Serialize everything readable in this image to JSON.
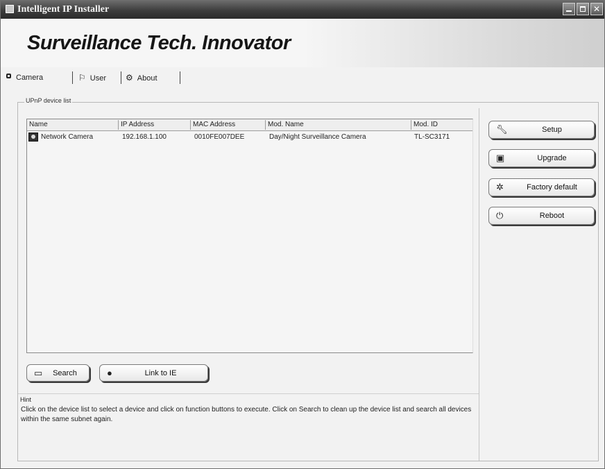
{
  "window": {
    "title": "Intelligent IP Installer"
  },
  "banner": {
    "brand": "Surveillance Tech. Innovator"
  },
  "tabs": [
    {
      "label": "Camera",
      "icon": "camera-icon"
    },
    {
      "label": "User",
      "icon": "user-icon"
    },
    {
      "label": "About",
      "icon": "info-icon"
    }
  ],
  "device_list": {
    "group_label": "UPnP device list",
    "columns": [
      "Name",
      "IP Address",
      "MAC Address",
      "Mod. Name",
      "Mod. ID"
    ],
    "rows": [
      {
        "name": "Network Camera",
        "ip": "192.168.1.100",
        "mac": "0010FE007DEE",
        "mod_name": "Day/Night Surveillance Camera",
        "mod_id": "TL-SC3171"
      }
    ]
  },
  "actions": {
    "setup": "Setup",
    "upgrade": "Upgrade",
    "factory_default": "Factory default",
    "reboot": "Reboot"
  },
  "bottom_buttons": {
    "search": "Search",
    "link": "Link to IE"
  },
  "hint": {
    "label": "Hint",
    "text": "Click on the device list to select a device and click on function buttons to execute. Click on Search to clean up the device list and search all devices  within the same subnet again."
  }
}
